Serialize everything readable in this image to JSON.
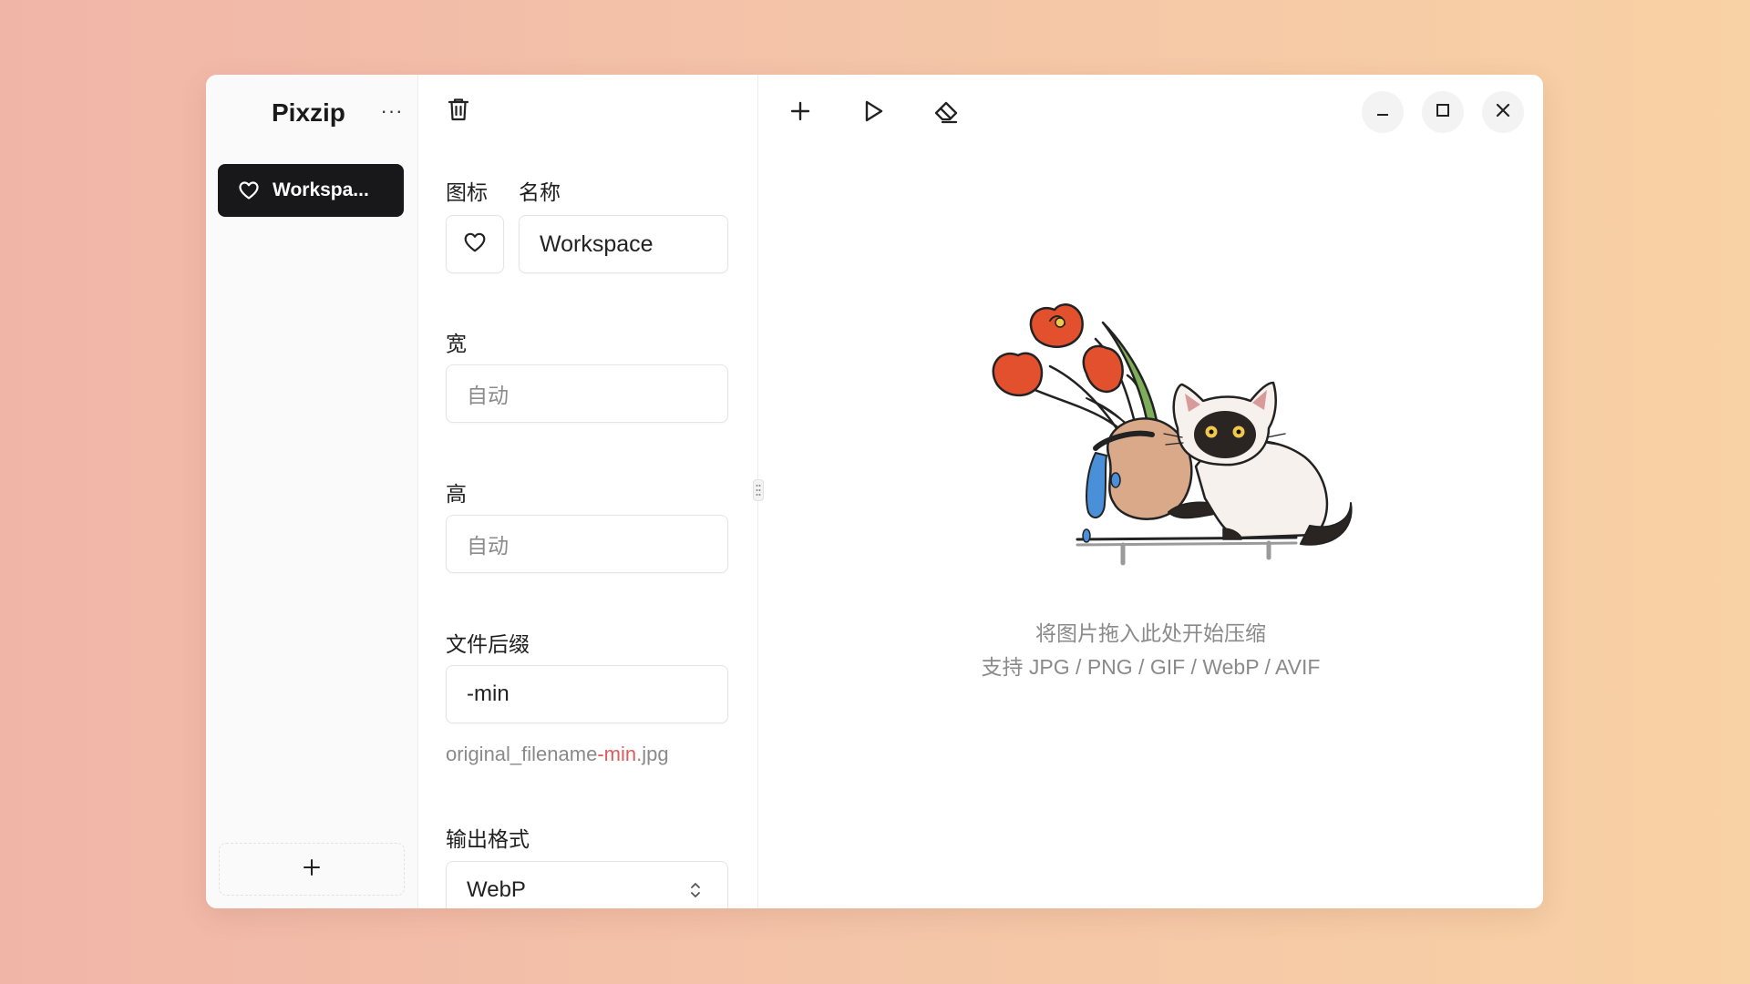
{
  "app": {
    "title": "Pixzip",
    "more_label": "···"
  },
  "sidebar": {
    "workspaces": [
      {
        "label": "Workspa...",
        "icon": "heart-icon",
        "active": true
      }
    ],
    "add_label": "+"
  },
  "settings": {
    "icon_label": "图标",
    "name_label": "名称",
    "name_value": "Workspace",
    "icon_value": "heart-icon",
    "width_label": "宽",
    "width_placeholder": "自动",
    "height_label": "高",
    "height_placeholder": "自动",
    "suffix_label": "文件后缀",
    "suffix_value": "-min",
    "preview_prefix": "original_filename",
    "preview_suffix": "-min",
    "preview_ext": ".jpg",
    "format_label": "输出格式",
    "format_value": "WebP"
  },
  "main": {
    "drop_hint": "将图片拖入此处开始压缩",
    "supported_formats": "支持 JPG / PNG / GIF / WebP / AVIF"
  },
  "colors": {
    "accent_dark": "#18181b",
    "suffix_highlight": "#e05a5a"
  }
}
